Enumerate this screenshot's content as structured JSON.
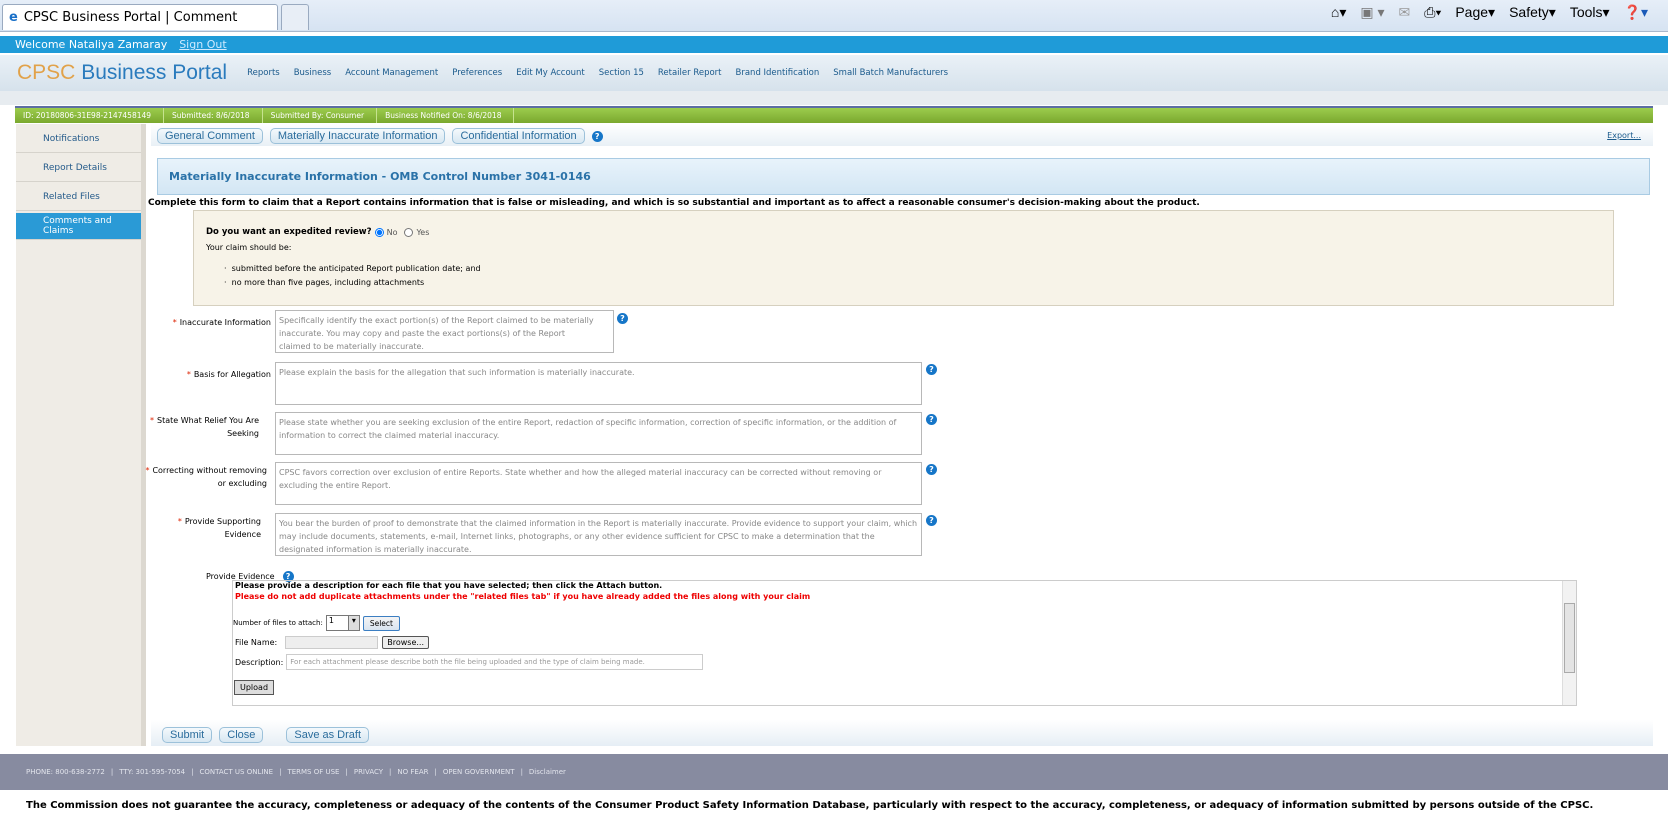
{
  "browser": {
    "tab_title": "CPSC Business Portal | Comment",
    "toolbar": [
      "Page",
      "Safety",
      "Tools"
    ],
    "icons": [
      "home-icon",
      "rss-icon",
      "mail-icon",
      "print-icon",
      "help-icon"
    ]
  },
  "welcome": {
    "text": "Welcome Nataliya Zamaray",
    "sign_out": "Sign Out"
  },
  "header": {
    "logo_a": "CPSC",
    "logo_b": " Business Portal",
    "nav": [
      "Reports",
      "Business",
      "Account Management",
      "Preferences",
      "Edit My Account",
      "Section 15",
      "Retailer Report",
      "Brand Identification",
      "Small Batch Manufacturers"
    ]
  },
  "infobar": [
    "ID: 20180806-31E98-2147458149",
    "Submitted: 8/6/2018",
    "Submitted By: Consumer",
    "Business Notified On: 8/6/2018"
  ],
  "sidebar": [
    {
      "label": "Notifications"
    },
    {
      "label": "Report Details"
    },
    {
      "label": "Related Files"
    },
    {
      "label": "Comments and Claims",
      "active": true
    }
  ],
  "tabs": [
    "General Comment",
    "Materially Inaccurate Information",
    "Confidential Information"
  ],
  "export": "Export...",
  "form": {
    "title": "Materially Inaccurate Information - OMB Control Number 3041-0146",
    "intro": "Complete this form to claim that a Report contains information that is false or misleading, and which is so substantial and important as to affect a reasonable consumer's decision-making about the product.",
    "expedited": {
      "question": "Do you want an expedited review?",
      "options": [
        "No",
        "Yes"
      ],
      "selected": "No",
      "claim_label": "Your claim should be:",
      "bullets": [
        "submitted before the anticipated Report publication date; and",
        "no more than five pages, including attachments"
      ]
    },
    "fields": [
      {
        "label": "Inaccurate Information",
        "placeholder": "Specifically identify the exact portion(s) of the Report claimed to be materially inaccurate.  You may copy and paste the exact portions(s) of the Report claimed to be materially inaccurate."
      },
      {
        "label": "Basis for Allegation",
        "placeholder": "Please explain the basis for the allegation that such information is materially inaccurate."
      },
      {
        "label": "State What Relief You Are Seeking",
        "placeholder": "Please state whether you are seeking exclusion of the entire Report, redaction of specific information, correction of specific information, or the addition of information to correct the claimed material inaccuracy."
      },
      {
        "label": "Correcting without removing or excluding",
        "placeholder": "CPSC favors correction over exclusion of entire Reports.  State whether and how the alleged material inaccuracy can be corrected without removing or excluding the entire Report."
      },
      {
        "label": "Provide Supporting Evidence",
        "placeholder": "You bear the burden of proof to demonstrate that the claimed information in the Report is materially inaccurate. Provide evidence to support your claim, which may include documents, statements, e-mail, Internet links, photographs, or any other evidence sufficient for CPSC to make a determination that the designated information is materially inaccurate."
      }
    ],
    "evidence": {
      "label": "Provide Evidence",
      "instruction": "Please provide a description for each file that you have selected; then click the Attach button.",
      "warning": "Please do not add duplicate attachments under the \"related files tab\" if you have already added the files along with your claim",
      "num_label": "Number of files to attach:",
      "num_value": "1",
      "select": "Select",
      "file_label": "File Name:",
      "browse": "Browse...",
      "desc_label": "Description:",
      "desc_placeholder": "For each attachment please describe both the file being uploaded and the type of claim being made.",
      "upload": "Upload"
    },
    "buttons": [
      "Submit",
      "Close",
      "Save as Draft"
    ]
  },
  "footer": [
    "PHONE: 800-638-2772",
    "TTY: 301-595-7054",
    "CONTACT US ONLINE",
    "TERMS OF USE",
    "PRIVACY",
    "NO FEAR",
    "OPEN GOVERNMENT",
    "Disclaimer"
  ],
  "disclaimer": "The Commission does not guarantee the accuracy, completeness or adequacy of the contents of the Consumer Product Safety Information Database, particularly with respect to the accuracy, completeness, or adequacy of information submitted by persons outside of the CPSC.",
  "colors": {
    "accent": "#1f9bd8",
    "green": "#8bbb3d",
    "footer": "#878ba0",
    "required": "#dd2200"
  }
}
